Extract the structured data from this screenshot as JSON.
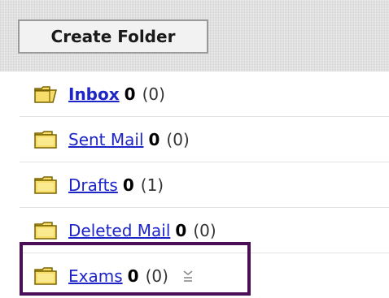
{
  "toolbar": {
    "create_folder_label": "Create Folder"
  },
  "folders": [
    {
      "name": "Inbox",
      "unread": "0",
      "total": "(0)",
      "bold": true,
      "icon": "open-folder-icon"
    },
    {
      "name": "Sent Mail",
      "unread": "0",
      "total": "(0)",
      "bold": false,
      "icon": "folder-icon"
    },
    {
      "name": "Drafts",
      "unread": "0",
      "total": "(1)",
      "bold": false,
      "icon": "folder-icon"
    },
    {
      "name": "Deleted Mail",
      "unread": "0",
      "total": "(0)",
      "bold": false,
      "icon": "folder-icon"
    },
    {
      "name": "Exams",
      "unread": "0",
      "total": "(0)",
      "bold": false,
      "icon": "folder-icon",
      "has_menu": true
    }
  ],
  "colors": {
    "link": "#1d24c8",
    "folder_fill": "#f7de6a",
    "folder_stroke": "#7a6200",
    "highlight_border": "#4a0f57"
  }
}
